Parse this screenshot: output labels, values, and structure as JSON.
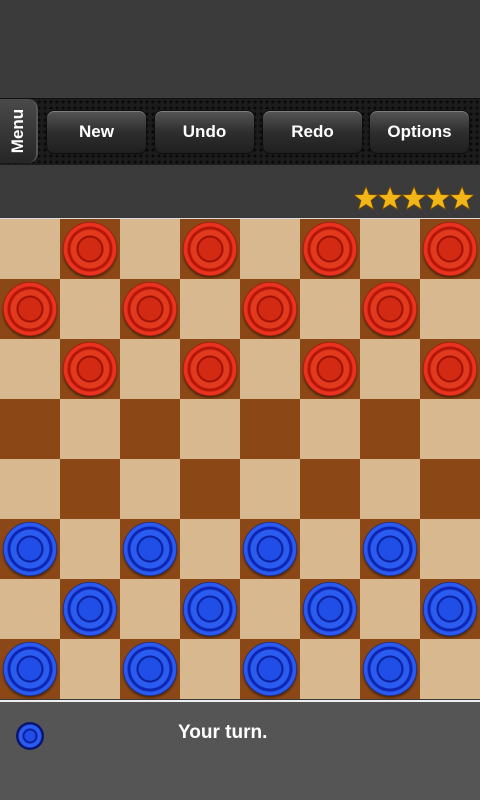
{
  "toolbar": {
    "menu_label": "Menu",
    "buttons": [
      {
        "label": "New"
      },
      {
        "label": "Undo"
      },
      {
        "label": "Redo"
      },
      {
        "label": "Options"
      }
    ]
  },
  "rating": {
    "stars": 5,
    "max": 5,
    "star_color": "#f2b619"
  },
  "board": {
    "size": 8,
    "light_color": "#d8b88e",
    "dark_color": "#8b4716",
    "pieces": [
      [
        null,
        "red",
        null,
        "red",
        null,
        "red",
        null,
        "red"
      ],
      [
        "red",
        null,
        "red",
        null,
        "red",
        null,
        "red",
        null
      ],
      [
        null,
        "red",
        null,
        "red",
        null,
        "red",
        null,
        "red"
      ],
      [
        null,
        null,
        null,
        null,
        null,
        null,
        null,
        null
      ],
      [
        null,
        null,
        null,
        null,
        null,
        null,
        null,
        null
      ],
      [
        "blue",
        null,
        "blue",
        null,
        "blue",
        null,
        "blue",
        null
      ],
      [
        null,
        "blue",
        null,
        "blue",
        null,
        "blue",
        null,
        "blue"
      ],
      [
        "blue",
        null,
        "blue",
        null,
        "blue",
        null,
        "blue",
        null
      ]
    ]
  },
  "status": {
    "current_player": "blue",
    "message": "Your turn."
  }
}
